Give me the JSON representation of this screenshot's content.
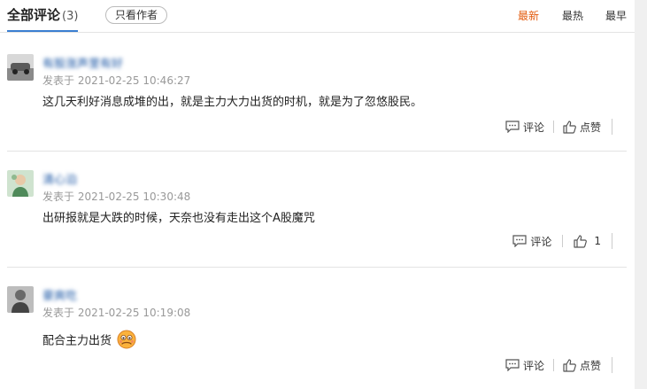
{
  "header": {
    "title": "全部评论",
    "count": "(3)",
    "author_only": "只看作者",
    "sort_tabs": [
      "最新",
      "最热",
      "最早"
    ],
    "active_sort": "最新"
  },
  "comments": [
    {
      "username": "有股涨声里有好",
      "time": "发表于 2021-02-25 10:46:27",
      "content": "这几天利好消息成堆的出，就是主力大力出货的时机，就是为了忽悠股民。",
      "reply_label": "评论",
      "like_label": "点赞"
    },
    {
      "username": "清心泊",
      "time": "发表于 2021-02-25 10:30:48",
      "content": "出研报就是大跌的时候，天奈也没有走出这个A股魔咒",
      "reply_label": "评论",
      "like_label": "1"
    },
    {
      "username": "豪爽吃",
      "time": "发表于 2021-02-25 10:19:08",
      "content": "配合主力出货",
      "reply_label": "评论",
      "like_label": "点赞"
    }
  ],
  "colors": {
    "active_sort": "#e35c0f",
    "username": "#1a56a5",
    "timestamp": "#999999",
    "tab_underline": "#3b7fd1"
  },
  "icons": [
    "comment-icon",
    "thumbs-up-icon",
    "worried-face-emoji"
  ]
}
